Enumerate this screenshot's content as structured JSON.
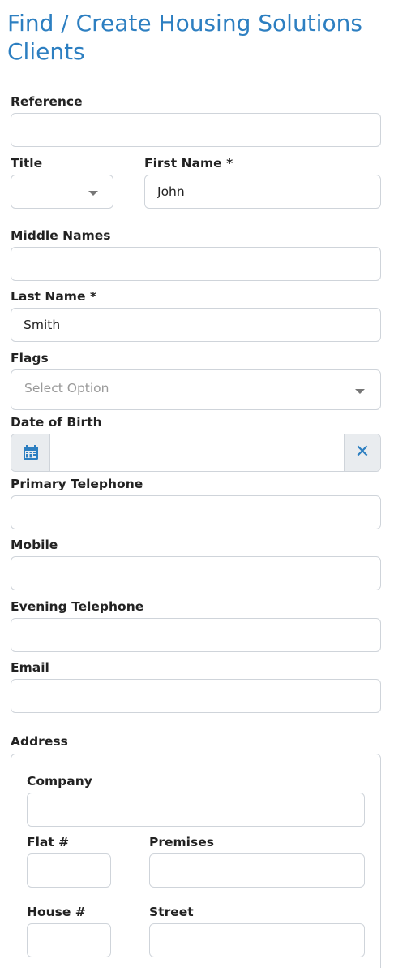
{
  "page": {
    "title": "Find / Create Housing Solutions Clients"
  },
  "form": {
    "reference": {
      "label": "Reference",
      "value": ""
    },
    "title": {
      "label": "Title",
      "value": ""
    },
    "first_name": {
      "label": "First Name *",
      "value": "John"
    },
    "middle_names": {
      "label": "Middle Names",
      "value": ""
    },
    "last_name": {
      "label": "Last Name *",
      "value": "Smith"
    },
    "flags": {
      "label": "Flags",
      "placeholder": "Select Option"
    },
    "dob": {
      "label": "Date of Birth",
      "value": "",
      "calendar_icon": "calendar-icon",
      "clear_icon": "close-icon",
      "clear_glyph": "✕"
    },
    "primary_tel": {
      "label": "Primary Telephone",
      "value": ""
    },
    "mobile": {
      "label": "Mobile",
      "value": ""
    },
    "evening_tel": {
      "label": "Evening Telephone",
      "value": ""
    },
    "email": {
      "label": "Email",
      "value": ""
    }
  },
  "address": {
    "label": "Address",
    "company": {
      "label": "Company",
      "value": ""
    },
    "flat": {
      "label": "Flat #",
      "value": ""
    },
    "premises": {
      "label": "Premises",
      "value": ""
    },
    "house": {
      "label": "House #",
      "value": ""
    },
    "street": {
      "label": "Street",
      "value": ""
    }
  },
  "colors": {
    "accent": "#2d7fc1",
    "border": "#cfd4da",
    "addon_bg": "#e9ecef"
  }
}
